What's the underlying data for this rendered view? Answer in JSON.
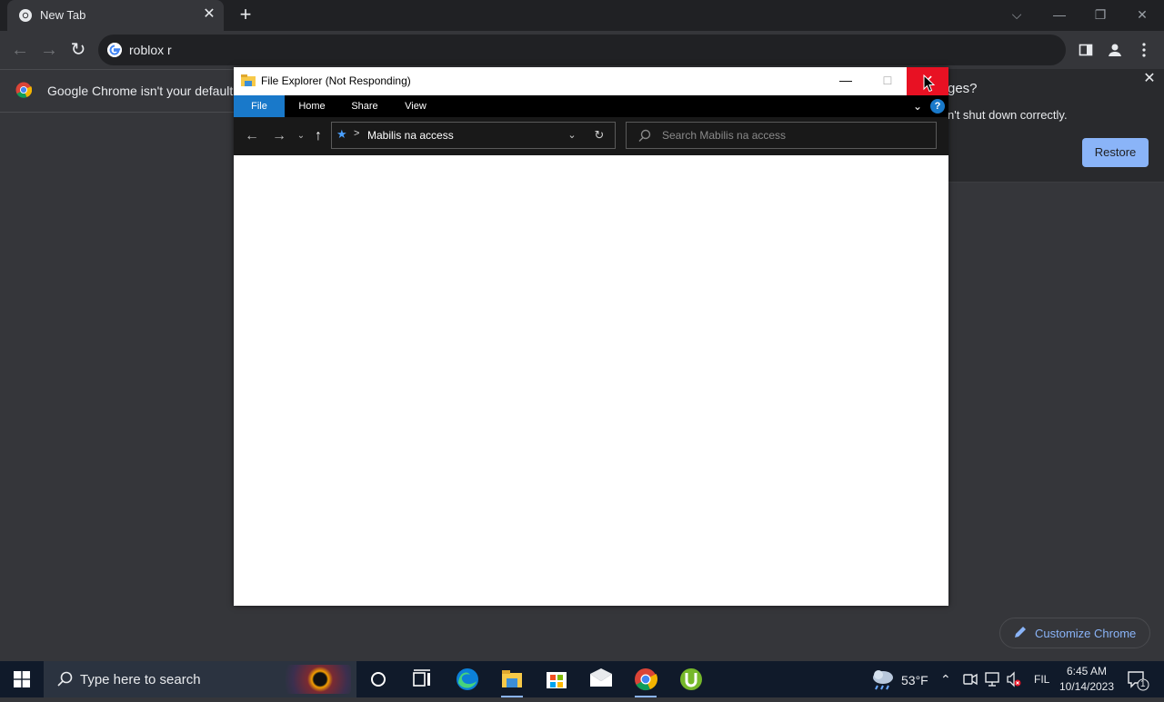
{
  "browser": {
    "tab": {
      "title": "New Tab",
      "close_glyph": "✕"
    },
    "new_tab_glyph": "+",
    "window_controls": {
      "tab_search": "⌵",
      "minimize": "—",
      "restore": "❐",
      "close": "✕"
    },
    "toolbar": {
      "back_glyph": "←",
      "forward_glyph": "→",
      "reload_glyph": "↻",
      "omnibox_text": "roblox r"
    },
    "infobar": {
      "text": "Google Chrome isn't your default br"
    },
    "restore_bubble": {
      "title": "ges?",
      "message": "n't shut down correctly.",
      "button_label": "Restore",
      "close_glyph": "✕"
    },
    "customize_button": {
      "label": "Customize Chrome"
    }
  },
  "explorer": {
    "title": "File Explorer (Not Responding)",
    "ribbon_tabs": [
      "File",
      "Home",
      "Share",
      "View"
    ],
    "address": {
      "location": "Mabilis na access",
      "separator": ">"
    },
    "search": {
      "placeholder": "Search Mabilis na access"
    },
    "help_glyph": "?"
  },
  "taskbar": {
    "search_placeholder": "Type here to search",
    "weather": {
      "temperature": "53°F"
    },
    "language": "FIL",
    "clock": {
      "time": "6:45 AM",
      "date": "10/14/2023"
    },
    "notification_count": "1",
    "pinned_apps": [
      "cortana",
      "task-view",
      "edge",
      "file-explorer",
      "microsoft-store",
      "mail",
      "chrome",
      "utorrent"
    ]
  },
  "colors": {
    "chrome_bg": "#35363a",
    "accent_blue": "#8ab4f8",
    "explorer_close_red": "#e81123",
    "explorer_file_tab": "#1979ca",
    "taskbar_bg": "#101a2a"
  }
}
